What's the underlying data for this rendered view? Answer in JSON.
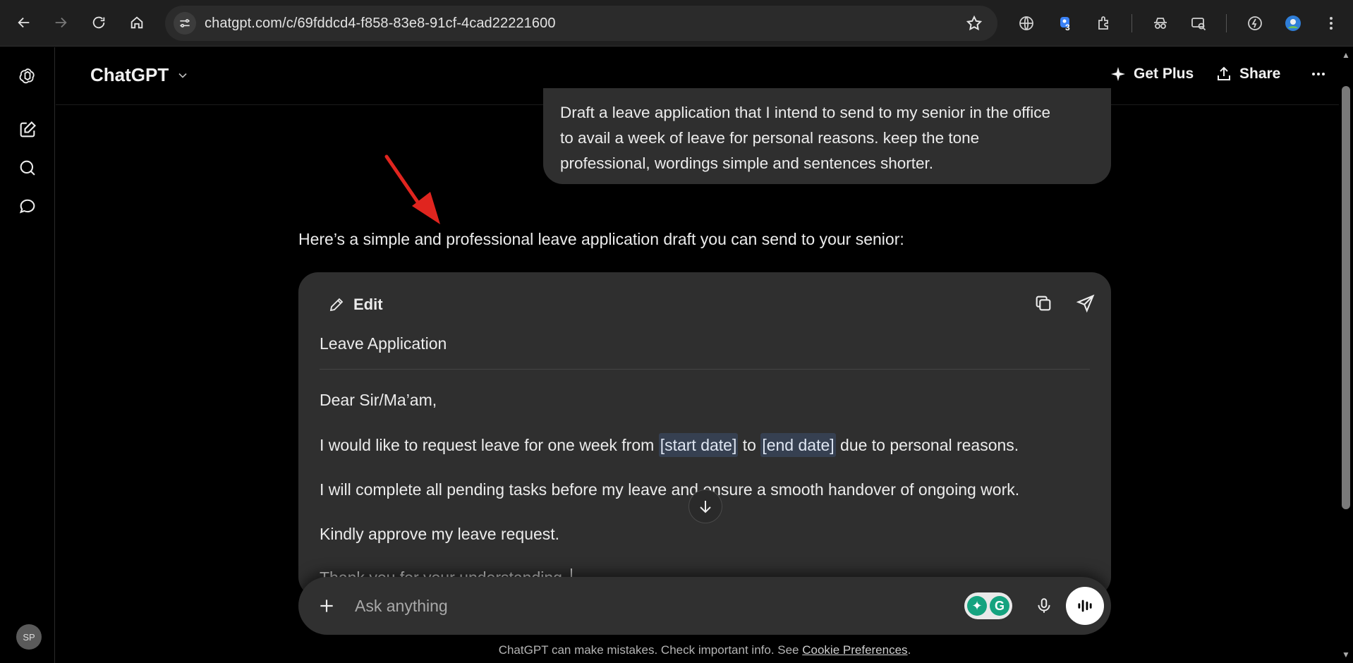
{
  "browser": {
    "url": "chatgpt.com/c/69fddcd4-f858-83e8-91cf-4cad22221600",
    "extension_badge": "3"
  },
  "sidebar": {
    "avatar_initials": "SP"
  },
  "header": {
    "brand": "ChatGPT",
    "get_plus_label": "Get Plus",
    "share_label": "Share"
  },
  "conversation": {
    "user_message_lines": [
      "Draft a leave application that I intend to send to my senior in the office",
      "to avail a week of leave for personal reasons. keep the tone",
      "professional, wordings simple and sentences shorter."
    ],
    "assistant_intro": "Here’s a simple and professional leave application draft you can send to your senior:"
  },
  "canvas": {
    "edit_label": "Edit",
    "title": "Leave Application",
    "greeting": "Dear Sir/Ma’am,",
    "para1": {
      "pre": "I would like to request leave for one week from ",
      "ph1": "[start date]",
      "mid": " to ",
      "ph2": "[end date]",
      "post": " due to personal reasons."
    },
    "para2": "I will complete all pending tasks before my leave and ensure a smooth handover of ongoing work.",
    "para3": "Kindly approve my leave request.",
    "para4_partial": "Thank you for your understanding."
  },
  "composer": {
    "placeholder": "Ask anything"
  },
  "footer": {
    "note_text": "ChatGPT can make mistakes. Check important info. See ",
    "link_text": "Cookie Preferences",
    "note_end": "."
  },
  "colors": {
    "background": "#000000",
    "bubble": "#2f2f2f",
    "placeholder_highlight": "#364051",
    "annotation_arrow": "#e0251f"
  }
}
